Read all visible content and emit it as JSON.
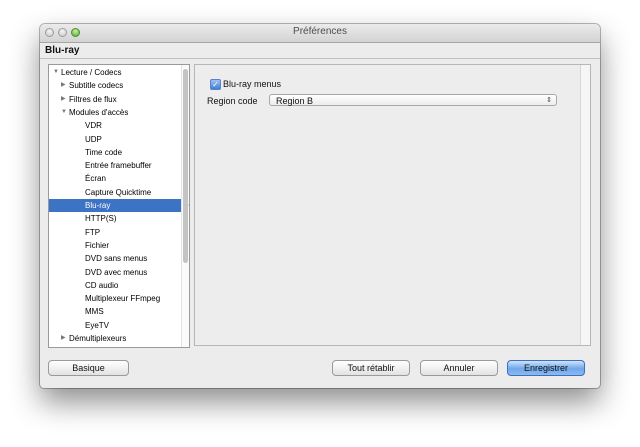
{
  "window": {
    "title": "Préférences"
  },
  "section_title": "Blu-ray",
  "tree": {
    "items": [
      {
        "label": "Lecture / Codecs",
        "indent": 0,
        "arrow": "open"
      },
      {
        "label": "Subtitle codecs",
        "indent": 1,
        "arrow": "closed"
      },
      {
        "label": "Filtres de flux",
        "indent": 1,
        "arrow": "closed"
      },
      {
        "label": "Modules d'accès",
        "indent": 1,
        "arrow": "open"
      },
      {
        "label": "VDR",
        "indent": 2
      },
      {
        "label": "UDP",
        "indent": 2
      },
      {
        "label": "Time code",
        "indent": 2
      },
      {
        "label": "Entrée framebuffer",
        "indent": 2
      },
      {
        "label": "Écran",
        "indent": 2
      },
      {
        "label": "Capture Quicktime",
        "indent": 2
      },
      {
        "label": "Blu-ray",
        "indent": 2,
        "selected": true
      },
      {
        "label": "HTTP(S)",
        "indent": 2
      },
      {
        "label": "FTP",
        "indent": 2
      },
      {
        "label": "Fichier",
        "indent": 2
      },
      {
        "label": "DVD sans menus",
        "indent": 2
      },
      {
        "label": "DVD avec menus",
        "indent": 2
      },
      {
        "label": "CD audio",
        "indent": 2
      },
      {
        "label": "Multiplexeur FFmpeg",
        "indent": 2
      },
      {
        "label": "MMS",
        "indent": 2
      },
      {
        "label": "EyeTV",
        "indent": 2
      },
      {
        "label": "Démultiplexeurs",
        "indent": 1,
        "arrow": "closed"
      }
    ]
  },
  "settings": {
    "bluray_menus": {
      "label": "Blu-ray menus",
      "checked": true
    },
    "region_code": {
      "label": "Region code",
      "value": "Region B"
    }
  },
  "buttons": {
    "basic": "Basique",
    "reset": "Tout rétablir",
    "cancel": "Annuler",
    "save": "Enregistrer"
  },
  "colors": {
    "selection": "#3d73c4",
    "primary_button": "#6fa7ea"
  }
}
